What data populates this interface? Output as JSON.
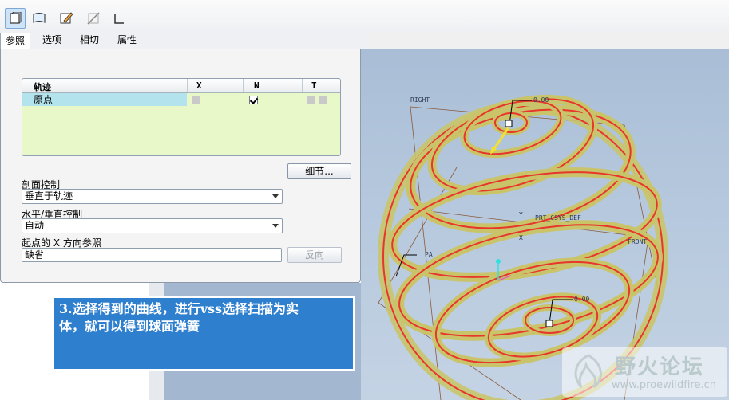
{
  "toolbar": {
    "icons": [
      "solid-sweep-icon",
      "surface-sweep-icon",
      "sketch-edit-icon",
      "cut-icon",
      "thin-icon"
    ]
  },
  "tabs": [
    "参照",
    "选项",
    "相切",
    "属性"
  ],
  "trajectory_table": {
    "headers": [
      "轨迹",
      "X",
      "N",
      "T"
    ],
    "rows": [
      {
        "name": "原点",
        "x": false,
        "n": true,
        "t": false
      }
    ]
  },
  "details_button": "细节...",
  "section_control": {
    "label": "剖面控制",
    "value": "垂直于轨迹"
  },
  "hv_control": {
    "label": "水平/垂直控制",
    "value": "自动"
  },
  "start_x_ref": {
    "label": "起点的 X 方向参照",
    "value": "缺省",
    "flip_button": "反向"
  },
  "viewport_labels": {
    "right": "RIGHT",
    "front": "FRONT",
    "csys": "PRT_CSYS_DEF",
    "dim_top": "0.00",
    "dim_bottom": "0.00",
    "pa": "PA",
    "x_axis": "X",
    "y_axis": "Y"
  },
  "caption": {
    "line1": "3.选择得到的曲线，进行vss选择扫描为实",
    "line2": "体，就可以得到球面弹簧"
  },
  "watermark": {
    "title": "野火论坛",
    "url": "www.proewildfire.cn"
  },
  "colors": {
    "caption_bg": "#2f7fcf",
    "coil_yellow": "#d8d47a",
    "coil_red": "#e8362b",
    "row_highlight": "#b3e4ee"
  }
}
